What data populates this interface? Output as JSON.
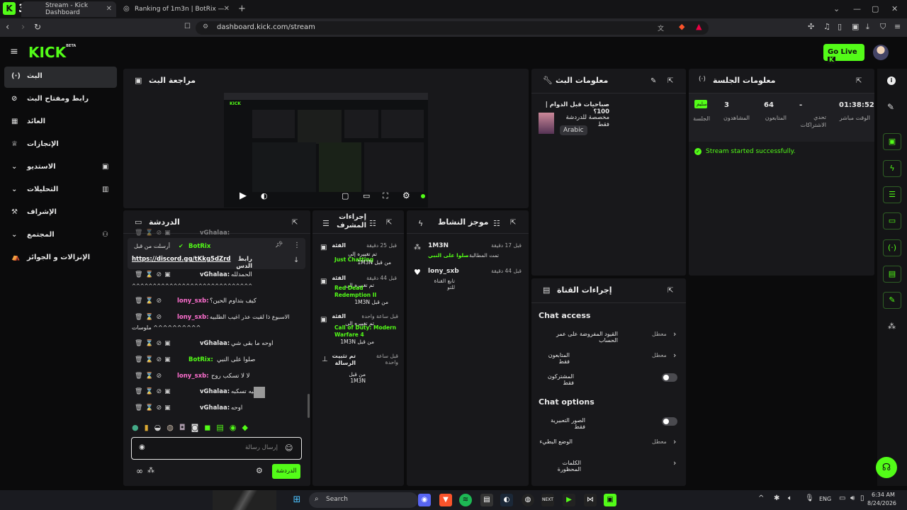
{
  "browser": {
    "tabs": [
      {
        "title": "Stream - Kick Dashboard"
      },
      {
        "title": "Ranking of 1m3n | BotRix — Cloud S"
      }
    ],
    "new_tab": "+",
    "url": "dashboard.kick.com/stream",
    "notification_badge": "3"
  },
  "header": {
    "logo": "KICK",
    "logo_beta": "BETA",
    "go_live": "Go Live"
  },
  "sidebar": {
    "items": [
      {
        "label": "البث"
      },
      {
        "label": "رابط ومفتاح البث"
      },
      {
        "label": "العائد"
      },
      {
        "label": "الإنجازات"
      },
      {
        "label": "الاستديو"
      },
      {
        "label": "التحليلات"
      },
      {
        "label": "الإشراف"
      },
      {
        "label": "المجتمع"
      },
      {
        "label": "الإنزالات و الجوائز"
      }
    ]
  },
  "preview": {
    "title": "مراجعة البث"
  },
  "stream_info": {
    "title": "معلومات البث",
    "stream_title": "صباحيات قبل الدوام | 100؟",
    "category": "مخصصة للدردشة فقط",
    "language": "Arabic"
  },
  "session": {
    "title": "معلومات الجلسة",
    "stats": [
      {
        "value": "01:38:52",
        "label": "الوقت مباشر"
      },
      {
        "value": "-",
        "label": "تحدي الاشتراكات"
      },
      {
        "value": "64",
        "label": "المتابعون"
      },
      {
        "value": "3",
        "label": "المشاهدون"
      },
      {
        "value": "سليم",
        "label": "الجلسة"
      }
    ],
    "status": "Stream started successfully."
  },
  "chat": {
    "title": "الدردشة",
    "pinned_by": "أرسلت من قبل",
    "pinned_user": "BotRix",
    "pinned_label": "رابط الدس",
    "pinned_link": "https://discord.gg/tKkg5dZrd",
    "messages": [
      {
        "user": "vGhalaa:",
        "text": "الحمدلله",
        "color": "#e6e6e6"
      },
      {
        "user": "",
        "text": "^^^^^^^^^^^^^^^^^^^^^^^^^^^^^^^^^^^^^^^^^^^",
        "color": "#e6e6e6"
      },
      {
        "user": "lony_sxb:",
        "text": "كيف بتداوم الحين؟",
        "color": "#ff6fd0"
      },
      {
        "user": "lony_sxb:",
        "text": "الاسبوع ذا لقيت عذر اغيب الطلبيه",
        "color": "#ff6fd0"
      },
      {
        "user": "",
        "text": "ملوسات ^^^^^^^^^^",
        "color": "#e6e6e6"
      },
      {
        "user": "vGhalaa:",
        "text": "اوحه ما بقى شي",
        "color": "#e6e6e6"
      },
      {
        "user": "BotRix:",
        "text": "صلوا على النبي",
        "color": "#53fc18"
      },
      {
        "user": "lony_sxb:",
        "text": "لا لا تسكب روح",
        "color": "#ff6fd0"
      },
      {
        "user": "vGhalaa:",
        "text": "ليه تسكبه",
        "color": "#e6e6e6"
      },
      {
        "user": "vGhalaa:",
        "text": "اوحه",
        "color": "#e6e6e6"
      }
    ],
    "input_placeholder": "إرسال رسالة",
    "send_button": "الدردشة"
  },
  "mod_actions": {
    "title": "إجراءات المشرف",
    "items": [
      {
        "type": "الفئة",
        "time": "قبل 25 دقيقة",
        "line1": "تم تغييره إلى",
        "value": "Just Chatting",
        "by": "من قبل 1M3N"
      },
      {
        "type": "الفئة",
        "time": "قبل 44 دقيقة",
        "line1": "تم تغييره إلى",
        "value": "Red Dead Redemption II",
        "by": "من قبل 1M3N"
      },
      {
        "type": "الفئة",
        "time": "قبل ساعة واحدة",
        "line1": "تم تغييره إلى",
        "value": "Call of Duty: Modern Warfare 4",
        "by": "من قبل 1M3N"
      },
      {
        "type": "تم تثبيت الرسالة",
        "time": "قبل ساعة واحدة",
        "line1": "",
        "value": "",
        "by": "من قبل 1M3N"
      }
    ]
  },
  "activity": {
    "title": "موجز النشاط",
    "items": [
      {
        "user": "1M3N",
        "time": "قبل 17 دقيقة",
        "detail": "تمت المطالبة",
        "detail2": "صلوا على النبي"
      },
      {
        "user": "lony_sxb",
        "time": "قبل 44 دقيقة",
        "detail": "تابع القناة للتو",
        "detail2": ""
      }
    ]
  },
  "channel_actions": {
    "title": "إجراءات القناة",
    "chat_access": "Chat access",
    "access_rows": [
      {
        "label": "القيود المفروضة على عمر الحساب",
        "value": "معطل"
      },
      {
        "label": "المتابعون فقط",
        "value": "معطل"
      },
      {
        "label": "المشتركون فقط",
        "value": ""
      }
    ],
    "chat_options": "Chat options",
    "option_rows": [
      {
        "label": "الصور التعبيرية فقط",
        "value": ""
      },
      {
        "label": "الوضع البطيء",
        "value": "معطل"
      },
      {
        "label": "الكلمات المحظورة",
        "value": ""
      }
    ]
  },
  "taskbar": {
    "search": "Search",
    "lang": "ENG",
    "time": "6:34 AM",
    "date": "8/24/2026"
  }
}
